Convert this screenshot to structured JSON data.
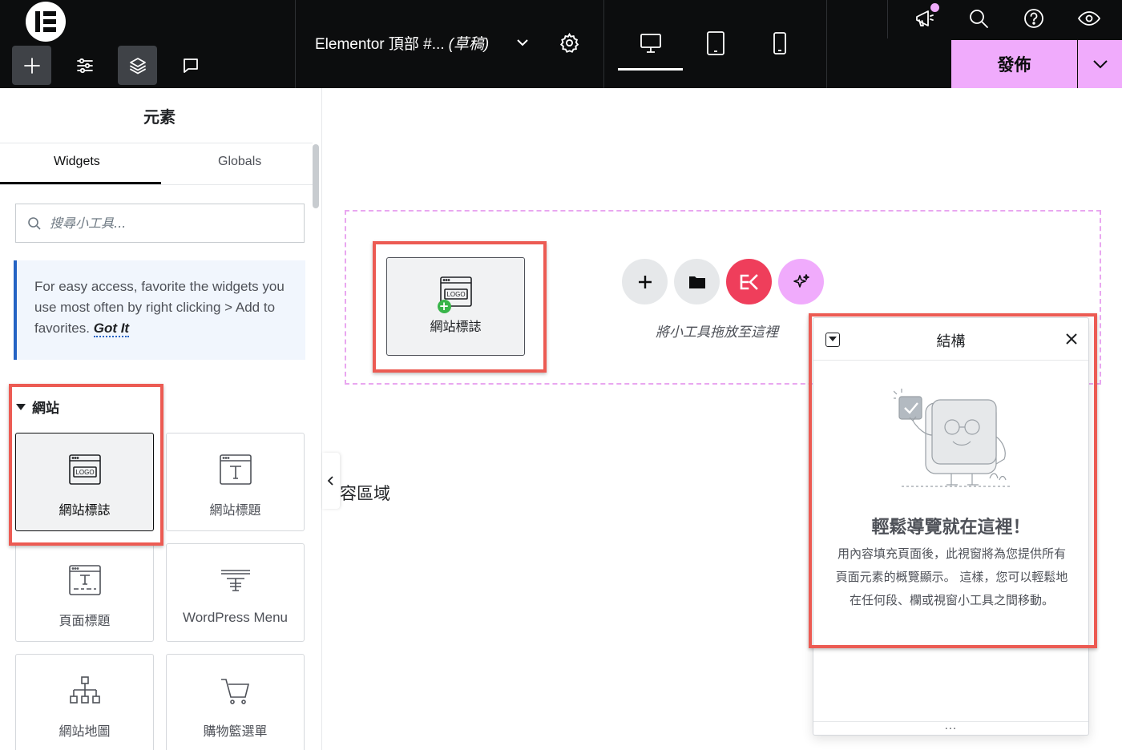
{
  "topbar": {
    "document_title": "Elementor 頂部 #...",
    "document_status": "(草稿)",
    "publish_label": "發佈",
    "device_active": "desktop",
    "notification_dot_color": "#f0abfc",
    "icons": [
      "elementor-logo-icon",
      "add-element-icon",
      "site-settings-icon",
      "structure-icon",
      "notes-icon",
      "chevron-down-icon",
      "gear-icon",
      "desktop-icon",
      "tablet-icon",
      "mobile-icon",
      "announcement-icon",
      "search-icon",
      "help-icon",
      "preview-icon"
    ]
  },
  "panel": {
    "title": "元素",
    "tabs": [
      {
        "label": "Widgets",
        "active": true
      },
      {
        "label": "Globals",
        "active": false
      }
    ],
    "search_placeholder": "搜尋小工具...",
    "tip_text": "For easy access, favorite the widgets you use most often by right clicking > Add to favorites.",
    "tip_link": "Got It",
    "category": "網站",
    "widgets": [
      {
        "label": "網站標誌",
        "icon": "site-logo-icon",
        "selected": true
      },
      {
        "label": "網站標題",
        "icon": "site-title-icon",
        "selected": false
      },
      {
        "label": "頁面標題",
        "icon": "page-title-icon",
        "selected": false
      },
      {
        "label": "WordPress Menu",
        "icon": "nav-menu-icon",
        "selected": false
      },
      {
        "label": "網站地圖",
        "icon": "sitemap-icon",
        "selected": false
      },
      {
        "label": "購物籃選單",
        "icon": "cart-icon",
        "selected": false
      }
    ]
  },
  "canvas": {
    "dragging_widget_label": "網站標誌",
    "logo_icon_text": "LOGO",
    "drop_hint": "將小工具拖放至這裡",
    "area_text": "容區域",
    "action_buttons": [
      "add-section-icon",
      "template-library-icon",
      "elementskit-icon",
      "ai-sparkle-icon"
    ]
  },
  "structure_panel": {
    "title": "結構",
    "heading": "輕鬆導覽就在這裡！",
    "body": "用內容填充頁面後，此視窗將為您提供所有頁面元素的概覽顯示。 這樣，您可以輕鬆地在任何段、欄或視窗小工具之間移動。",
    "footer": "..."
  },
  "colors": {
    "topbar_bg": "#0c0d0e",
    "accent_pink": "#f0abfc",
    "highlight_red": "#ec5b53",
    "tip_border": "#2463c4",
    "elementskit_red": "#ef3e5b"
  }
}
